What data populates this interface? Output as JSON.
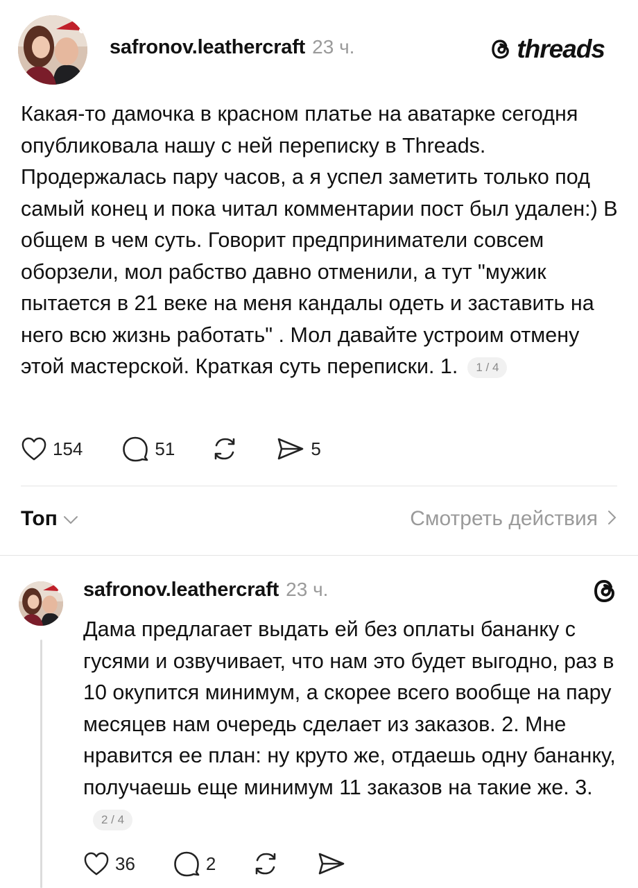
{
  "brand": {
    "name": "threads"
  },
  "post": {
    "username": "safronov.leathercraft",
    "time": "23 ч.",
    "text": "Какая-то дамочка в красном платье на аватарке сегодня опубликовала нашу с ней переписку в Threads. Продержалась пару часов, а я успел заметить только под самый конец и пока читал комментарии пост был удален:) В общем в чем суть. Говорит предприниматели совсем оборзели, мол рабство давно отменили, а тут \"мужик пытается в 21 веке на меня кандалы одеть и заставить на него всю жизнь работать\" . Мол давайте устроим отмену этой мастерской. Краткая суть переписки. 1.",
    "counter": "1 / 4",
    "likes": "154",
    "comments": "51",
    "shares": "5"
  },
  "sort": {
    "label": "Топ",
    "view_actions": "Смотреть действия"
  },
  "reply": {
    "username": "safronov.leathercraft",
    "time": "23 ч.",
    "text": "Дама предлагает выдать ей без оплаты бананку с гусями и озвучивает, что нам это будет выгодно, раз в 10 окупится минимум, а скорее всего вообще на пару месяцев нам очередь сделает из заказов. 2. Мне нравится ее план: ну круто же, отдаешь одну бананку, получаешь еще минимум 11 заказов на такие же. 3.",
    "counter": "2 / 4",
    "likes": "36",
    "comments": "2"
  },
  "icons": {
    "like": "heart-icon",
    "comment": "comment-bubble-icon",
    "repost": "repost-icon",
    "share": "send-icon",
    "brand": "threads-logo-icon"
  }
}
